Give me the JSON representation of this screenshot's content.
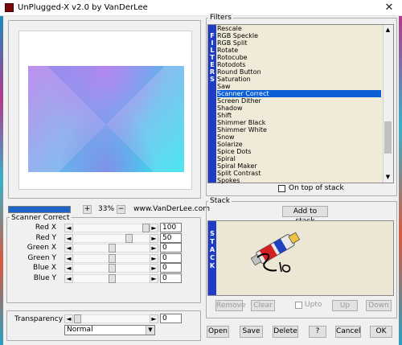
{
  "window": {
    "title": "UnPlugged-X v2.0 by VanDerLee",
    "close_glyph": "✕"
  },
  "preview": {
    "zoom": {
      "plus": "+",
      "minus": "−",
      "value": "33%",
      "progress": 1.0
    },
    "website": "www.VanDerLee.com"
  },
  "scanner": {
    "title": "Scanner Correct",
    "left_arrow": "◄",
    "right_arrow": "►",
    "params": [
      {
        "label": "Red X",
        "value": "100",
        "level": 1.0
      },
      {
        "label": "Red Y",
        "value": "50",
        "level": 0.75
      },
      {
        "label": "Green X",
        "value": "0",
        "level": 0.5
      },
      {
        "label": "Green Y",
        "value": "0",
        "level": 0.5
      },
      {
        "label": "Blue X",
        "value": "0",
        "level": 0.5
      },
      {
        "label": "Blue Y",
        "value": "0",
        "level": 0.5
      }
    ]
  },
  "transparency": {
    "label": "Transparency",
    "value": "0",
    "level": 0.0,
    "mode": "Normal",
    "dropdown_glyph": "▼"
  },
  "filters": {
    "title": "Filters",
    "strip_letters": [
      "F",
      "I",
      "L",
      "T",
      "E",
      "R",
      "S"
    ],
    "items": [
      "Rescale",
      "RGB Speckle",
      "RGB Split",
      "Rotate",
      "Rotocube",
      "Rotodots",
      "Round Button",
      "Saturation",
      "Saw",
      "Scanner Correct",
      "Screen Dither",
      "Shadow",
      "Shift",
      "Shimmer Black",
      "Shimmer White",
      "Snow",
      "Solarize",
      "Spice Dots",
      "Spiral",
      "Spiral Maker",
      "Split Contrast",
      "Spokes"
    ],
    "selected": "Scanner Correct",
    "scroll_up": "▲",
    "scroll_down": "▼",
    "on_top_label": "On top of stack"
  },
  "stack": {
    "title": "Stack",
    "add_label": "Add to stack",
    "strip_letters": [
      "S",
      "T",
      "A",
      "C",
      "K"
    ],
    "remove_label": "Remove",
    "clear_label": "Clear",
    "upto_label": "Upto",
    "up_label": "Up",
    "down_label": "Down"
  },
  "buttons": {
    "open": "Open",
    "save": "Save",
    "delete": "Delete",
    "help": "?",
    "cancel": "Cancel",
    "ok": "OK"
  },
  "colors": {
    "selection": "#0a5fd8",
    "strip": "#1e3cc8",
    "progress": "#1e64c8"
  }
}
